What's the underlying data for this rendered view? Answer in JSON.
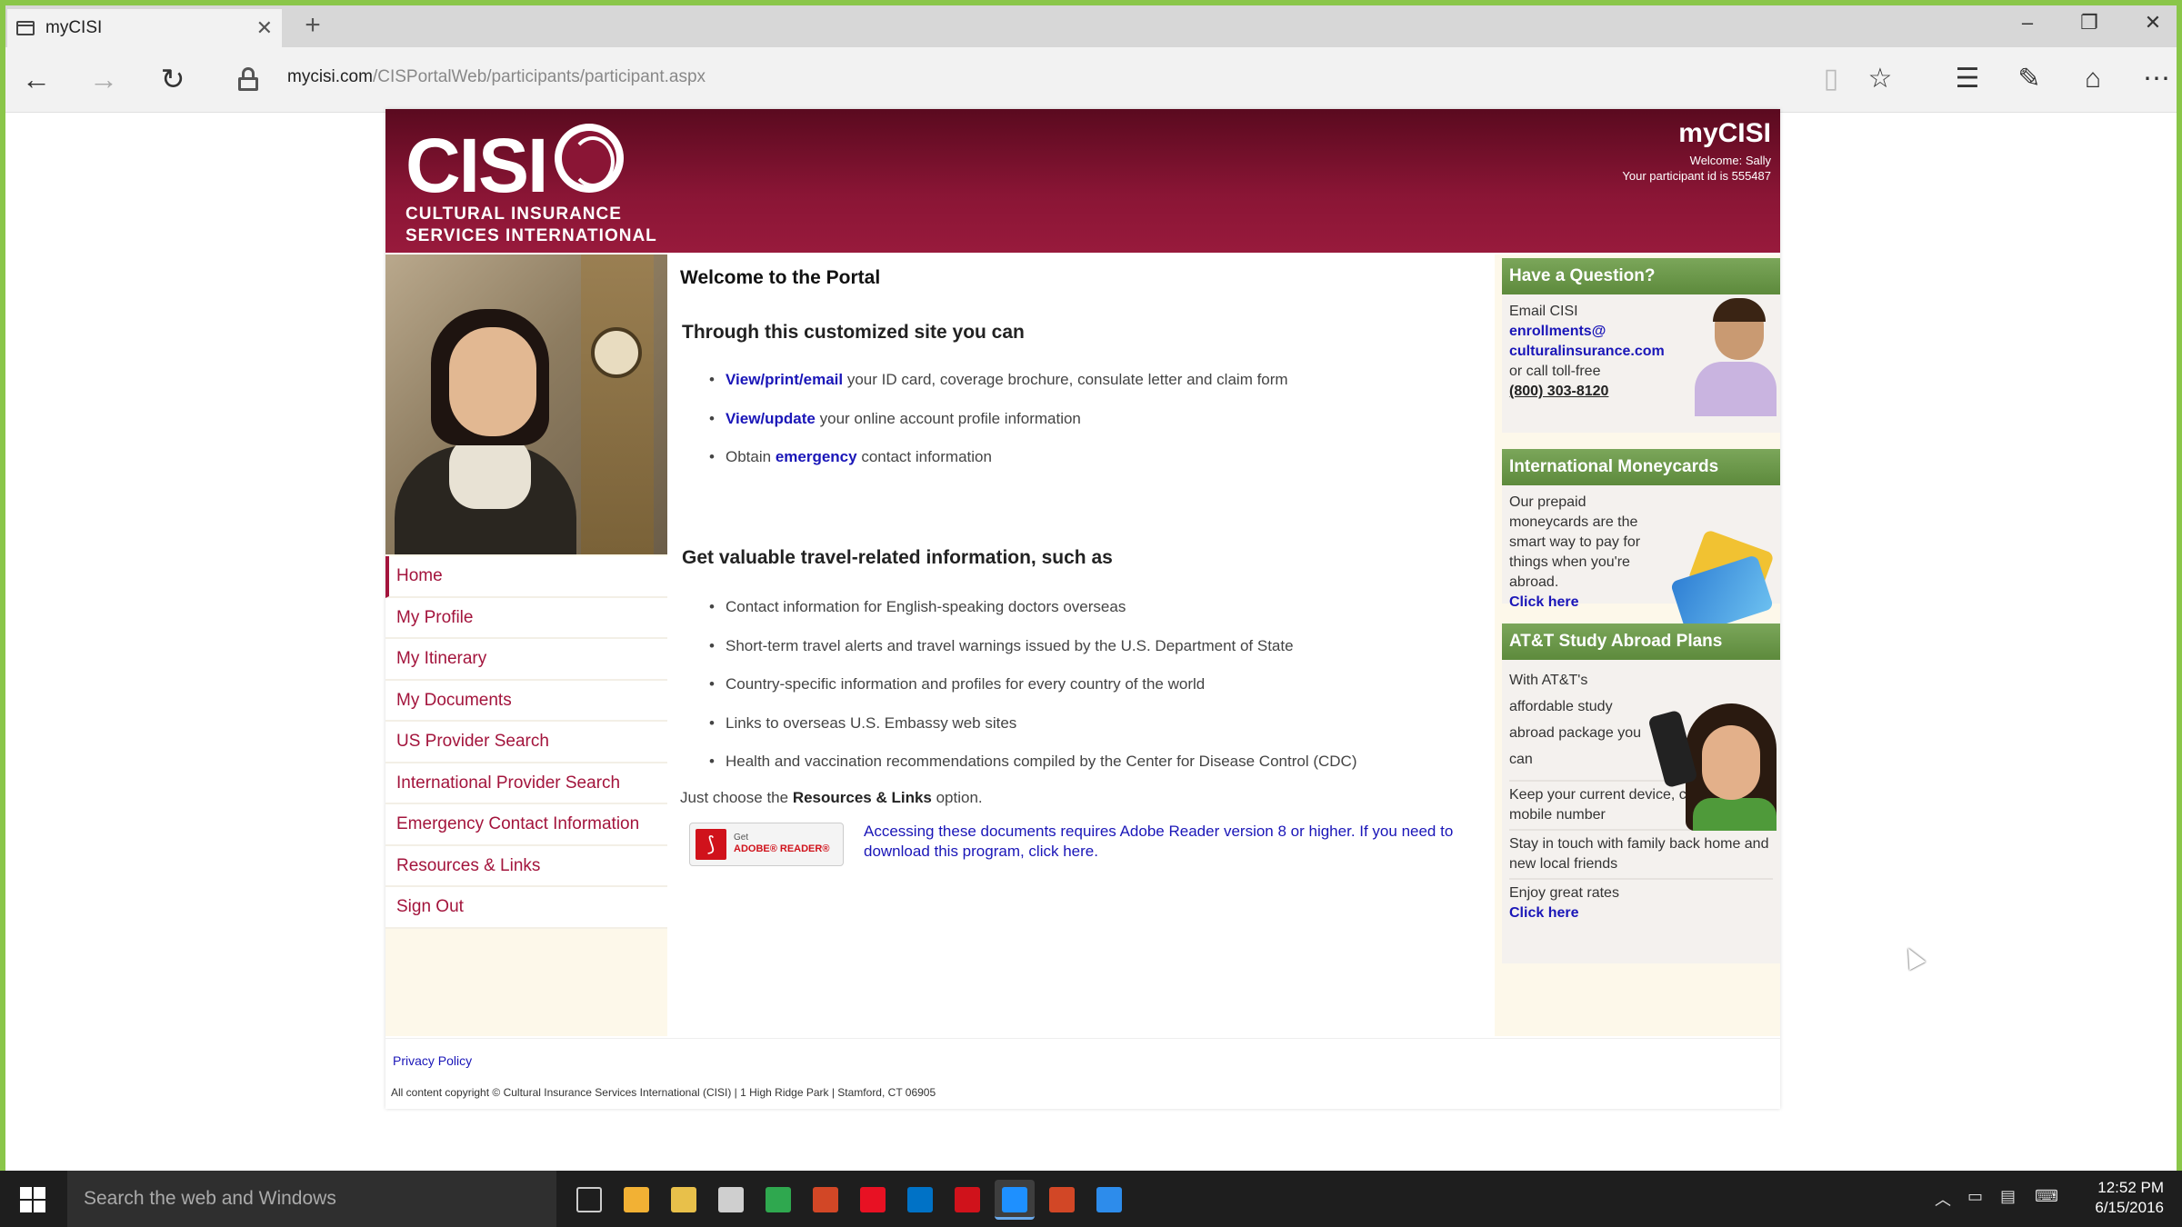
{
  "browser": {
    "tab_title": "myCISI",
    "new_tab": "+",
    "minimize": "–",
    "restore": "❐",
    "close": "✕",
    "tab_close": "✕",
    "url_domain": "mycisi.com",
    "url_path": "/CISPortalWeb/participants/participant.aspx",
    "back": "←",
    "forward": "→",
    "refresh": "↻",
    "reading_view": "▯",
    "favorite": "☆",
    "hub": "☰",
    "web_note": "✎",
    "share": "⌂",
    "more": "⋯"
  },
  "header": {
    "logo": "CISI",
    "logo_line1": "CULTURAL INSURANCE",
    "logo_line2": "SERVICES INTERNATIONAL",
    "site_name": "myCISI",
    "welcome": "Welcome: Sally",
    "participant": "Your participant id is 555487"
  },
  "menu": [
    {
      "label": "Home",
      "active": true
    },
    {
      "label": "My Profile"
    },
    {
      "label": "My Itinerary"
    },
    {
      "label": "My Documents"
    },
    {
      "label": "US Provider Search"
    },
    {
      "label": "International Provider Search"
    },
    {
      "label": "Emergency Contact Information"
    },
    {
      "label": "Resources & Links"
    },
    {
      "label": "Sign Out"
    }
  ],
  "main": {
    "title": "Welcome to the Portal",
    "section1_heading": "Through this customized site you can",
    "section1_items": [
      {
        "link": "View/print/email",
        "text": " your ID card, coverage brochure, consulate letter and claim form"
      },
      {
        "link": "View/update",
        "text": " your online account profile information"
      },
      {
        "prefix": "Obtain ",
        "link": "emergency",
        "text": " contact information"
      }
    ],
    "section2_heading": "Get valuable travel-related information, such as",
    "section2_items": [
      "Contact information for English-speaking doctors overseas",
      "Short-term travel alerts and travel warnings issued by the U.S. Department of State",
      "Country-specific information and profiles for every country of the world",
      "Links to overseas U.S. Embassy web sites",
      "Health and vaccination recommendations compiled by the Center for Disease Control (CDC)"
    ],
    "just_prefix": "Just choose the ",
    "just_bold": "Resources & Links",
    "just_suffix": " option.",
    "adobe_get": "Get",
    "adobe_reader": "ADOBE® READER®",
    "adobe_note": "Accessing these documents requires Adobe Reader version 8 or higher. If you need to download this program, click here."
  },
  "sidebar": {
    "question": {
      "heading": "Have a Question?",
      "email_label": "Email CISI",
      "email_line1": "enrollments@",
      "email_line2": "culturalinsurance.com",
      "call": "or call toll-free",
      "phone": "(800) 303-8120"
    },
    "moneycards": {
      "heading": "International Moneycards",
      "text": "Our prepaid moneycards are the smart way to pay for things when you're abroad.",
      "link": "Click here"
    },
    "att": {
      "heading": "AT&T Study Abroad Plans",
      "intro": "With AT&T's affordable study abroad package you can",
      "item1": "Keep your current device, content and mobile number",
      "item2": "Stay in touch with family back home and new local friends",
      "item3": "Enjoy great rates",
      "link": "Click here"
    }
  },
  "footer": {
    "privacy": "Privacy Policy",
    "copyright": "All content copyright © Cultural Insurance Services International (CISI) | 1 High Ridge Park | Stamford, CT 06905"
  },
  "taskbar": {
    "search_placeholder": "Search the web and Windows",
    "time": "12:52 PM",
    "date": "6/15/2016",
    "app_colors": [
      "#6a6a6a",
      "#f2b134",
      "#e8c04a",
      "#cfcfcf",
      "#2fa84f",
      "#d24726",
      "#e81123",
      "#0072c6",
      "#d0121b",
      "#1e90ff",
      "#d24726",
      "#2d8ceb"
    ]
  }
}
